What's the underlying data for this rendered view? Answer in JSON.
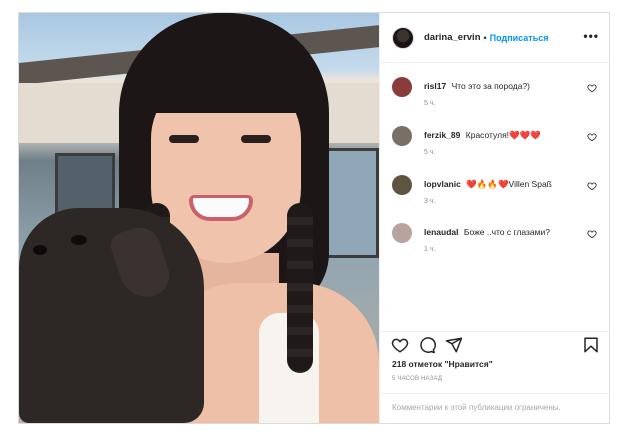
{
  "header": {
    "username": "darina_ervin",
    "separator": "•",
    "follow_label": "Подписаться",
    "more_label": "•••"
  },
  "comments": [
    {
      "username": "risl17",
      "text": "Что это за порода?)",
      "time": "5 ч.",
      "avatar_color": "#8a3b3b"
    },
    {
      "username": "ferzik_89",
      "text": "Красотуля!❤️❤️❤️",
      "time": "5 ч.",
      "avatar_color": "#7a6f66"
    },
    {
      "username": "lopvlanic",
      "text": "❤️🔥🔥❤️Villen Spaß",
      "time": "3 ч.",
      "avatar_color": "#5e5440"
    },
    {
      "username": "lenaudal",
      "text": "Боже ..что с глазами?",
      "time": "1 ч.",
      "avatar_color": "#b9a39f"
    }
  ],
  "actions": {
    "like_icon": "heart-outline-icon",
    "comment_icon": "comment-bubble-icon",
    "share_icon": "paper-plane-icon",
    "save_icon": "bookmark-icon"
  },
  "likes_text": "218 отметок \"Нравится\"",
  "time_ago": "5 ЧАСОВ НАЗАД",
  "comments_limited": "Комментарии к этой публикации ограничены."
}
